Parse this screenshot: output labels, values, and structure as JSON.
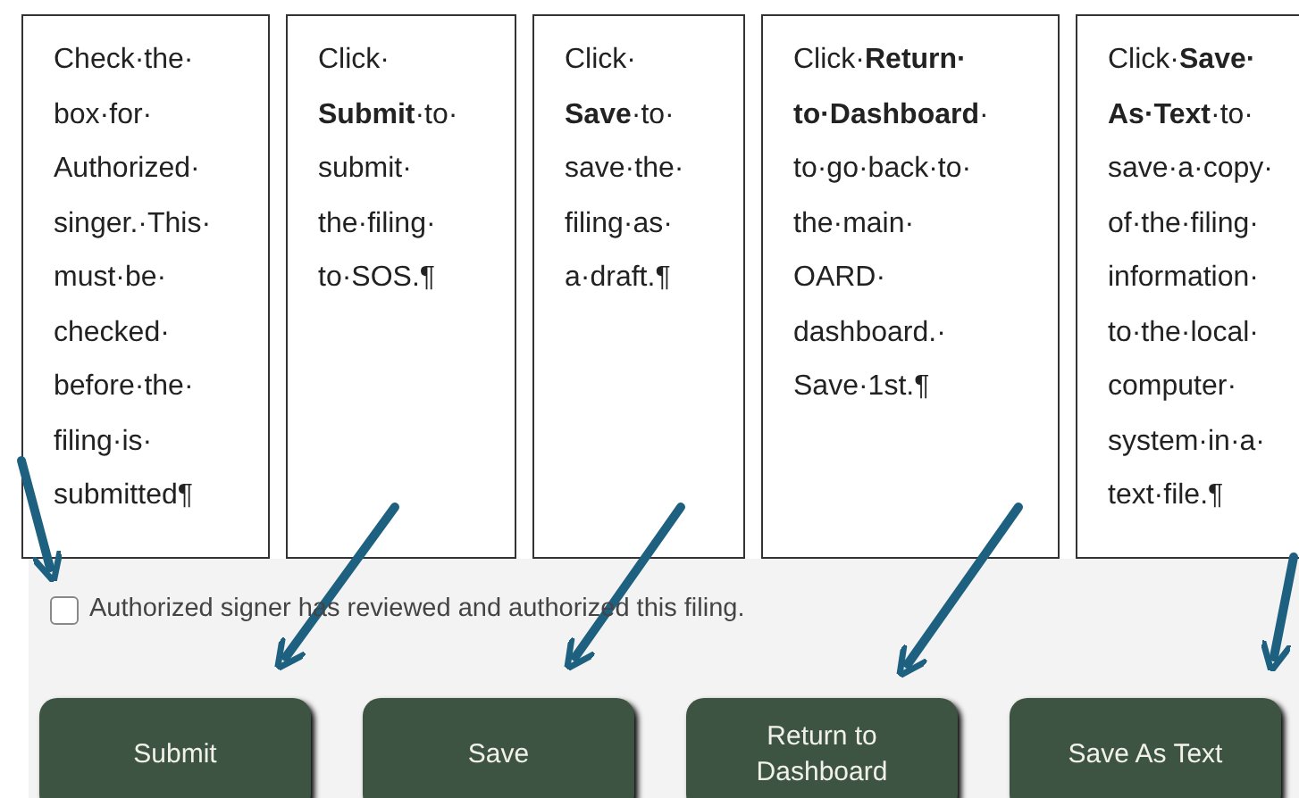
{
  "callouts": [
    {
      "lines": [
        "Check·the·",
        "box·for·",
        "Authorized·",
        "singer.·This·",
        "must·be·",
        "checked·",
        "before·the·",
        "filing·is·",
        "submitted¶"
      ]
    },
    {
      "lines": [
        "Click·",
        "**Submit**·to·",
        "submit·",
        "the·filing·",
        "to·SOS.¶"
      ]
    },
    {
      "lines": [
        "Click·",
        "**Save**·to·",
        "save·the·",
        "filing·as·",
        "a·draft.¶"
      ]
    },
    {
      "lines": [
        "Click·**Return·**",
        "**to·Dashboard**·",
        "to·go·back·to·",
        "the·main·",
        "OARD·",
        "dashboard.·",
        "Save·1st.¶"
      ]
    },
    {
      "lines": [
        "Click·**Save·**",
        "**As·Text**·to·",
        "save·a·copy·",
        "of·the·filing·",
        "information·",
        "to·the·local·",
        "computer·",
        "system·in·a·",
        "text·file.¶"
      ]
    }
  ],
  "checkbox": {
    "label": "Authorized signer has reviewed and authorized this filing.",
    "checked": false
  },
  "buttons": [
    {
      "lines": [
        "Submit"
      ]
    },
    {
      "lines": [
        "Save"
      ]
    },
    {
      "lines": [
        "Return to",
        "Dashboard"
      ]
    },
    {
      "lines": [
        "Save As Text"
      ]
    }
  ]
}
